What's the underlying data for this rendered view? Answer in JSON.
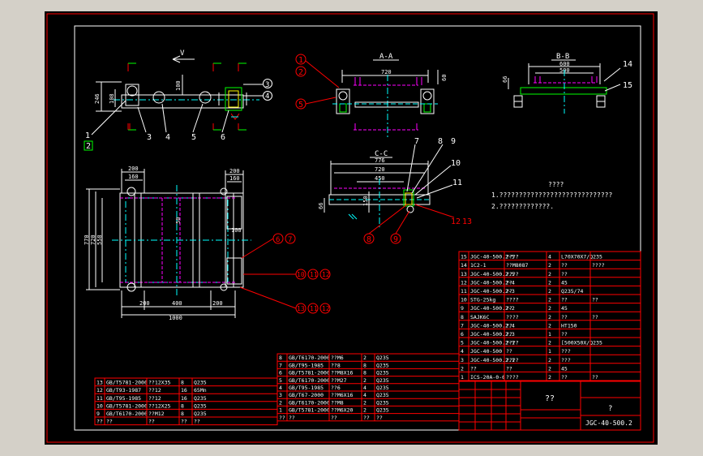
{
  "colors": {
    "background": "#000000",
    "outer_border": "#ff0000",
    "frame": "#ffffff",
    "dimension": "#ffffff",
    "balloon": "#ff0000",
    "hidden": "#ff00ff",
    "centerline": "#00ffff",
    "part": "#ffffff",
    "accent_green": "#00ff00",
    "accent_yellow": "#ffff00",
    "table_line": "#ff0000",
    "table_text": "#ffffff"
  },
  "views": {
    "front": {
      "arrow_label": "V",
      "dims": [
        "246",
        "108",
        "100"
      ]
    },
    "section_aa": {
      "title": "A-A",
      "dims": [
        "720",
        "60"
      ]
    },
    "section_bb": {
      "title": "B-B",
      "dims": [
        "600",
        "500",
        "66"
      ]
    },
    "section_cc": {
      "title": "C-C",
      "dims": [
        "776",
        "720",
        "450",
        "150",
        "66"
      ]
    },
    "plan": {
      "dims_top": [
        "200",
        "160",
        "200",
        "160"
      ],
      "dims_left": [
        "770",
        "720",
        "558"
      ],
      "dims_bottom": [
        "200",
        "400",
        "200",
        "1000"
      ],
      "dims_inner": [
        "50",
        "100"
      ]
    }
  },
  "balloons": {
    "front": [
      "1",
      "2",
      "3",
      "4",
      "5",
      "6",
      "3",
      "4"
    ],
    "section_aa": [
      "1",
      "2",
      "5"
    ],
    "section_bb": [
      "14",
      "15"
    ],
    "section_cc": [
      "7",
      "8",
      "9",
      "10",
      "11",
      "12",
      "13",
      "8",
      "9"
    ],
    "plan": [
      "6",
      "7",
      "10",
      "11",
      "12",
      "13",
      "11",
      "12"
    ]
  },
  "notes": {
    "title": "????",
    "line1": "1.?????????????????????????????",
    "line2": "2.?????????????."
  },
  "parts_table": {
    "rows": [
      [
        "15",
        "JGC-40-500.2-5",
        "????",
        "4",
        "L70X70X7/Q235",
        ""
      ],
      [
        "14",
        "1C2-1",
        "??M8087",
        "2",
        "??",
        "????"
      ],
      [
        "13",
        "JGC-40-500.2.5",
        "????",
        "2",
        "??",
        ""
      ],
      [
        "12",
        "JGC-40-500.2-4",
        "??",
        "2",
        "45",
        ""
      ],
      [
        "11",
        "JGC-40-500.2-3",
        "??",
        "2",
        "Q235/74",
        ""
      ],
      [
        "10",
        "STG-25kg",
        "????",
        "2",
        "??",
        "??"
      ],
      [
        "9",
        "JGC-40-500.2-2",
        "??",
        "2",
        "45",
        ""
      ],
      [
        "8",
        "SAJK6C",
        "????",
        "2",
        "??",
        "??"
      ],
      [
        "7",
        "JGC-40-500.2.4",
        "??",
        "2",
        "HT150",
        ""
      ],
      [
        "6",
        "JGC-40-500.2.3",
        "??",
        "1",
        "??",
        ""
      ],
      [
        "5",
        "JGC-40-500.2-1",
        "????",
        "2",
        "[500X50X/Q235",
        ""
      ],
      [
        "4",
        "JGC-40-500",
        "??",
        "1",
        "???",
        ""
      ],
      [
        "3",
        "JGC-40-500.2.1",
        "????",
        "2",
        "???",
        ""
      ],
      [
        "2",
        "??",
        "??",
        "2",
        "45",
        ""
      ],
      [
        "1",
        "ICS-20A-0-6",
        "????",
        "2",
        "??",
        "??"
      ]
    ],
    "title_block": {
      "name": "??",
      "mark": "?",
      "drawing_no": "JGC-40-500.2"
    }
  },
  "std_table_mid": {
    "rows": [
      [
        "8",
        "GB/T6170-2000",
        "??M6",
        "2",
        "Q235"
      ],
      [
        "7",
        "GB/T95-1985",
        "??8",
        "8",
        "Q235"
      ],
      [
        "6",
        "GB/T5781-2000",
        "??M8X16",
        "8",
        "Q235"
      ],
      [
        "5",
        "GB/T6170-2000",
        "??M27",
        "2",
        "Q235"
      ],
      [
        "4",
        "GB/T95-1985",
        "??6",
        "4",
        "Q235"
      ],
      [
        "3",
        "GB/T67-2000",
        "??M6X16",
        "4",
        "Q235"
      ],
      [
        "2",
        "GB/T6170-2000",
        "??M8",
        "2",
        "Q235"
      ],
      [
        "1",
        "GB/T5781-2000",
        "??M6X20",
        "2",
        "Q235"
      ]
    ],
    "header": [
      "??",
      "??",
      "??",
      "??",
      "??",
      "????"
    ]
  },
  "std_table_left": {
    "rows": [
      [
        "13",
        "GB/T5781-2000",
        "??12X35",
        "8",
        "Q235"
      ],
      [
        "12",
        "GB/T93-1987",
        "??12",
        "16",
        "65Mn"
      ],
      [
        "11",
        "GB/T95-1985",
        "??12",
        "16",
        "Q235"
      ],
      [
        "10",
        "GB/T5781-2000",
        "??12X25",
        "8",
        "Q235"
      ],
      [
        "9",
        "GB/T6170-2000",
        "??M12",
        "8",
        "Q235"
      ]
    ],
    "header": [
      "??",
      "??",
      "??",
      "??",
      "??",
      "????"
    ]
  }
}
